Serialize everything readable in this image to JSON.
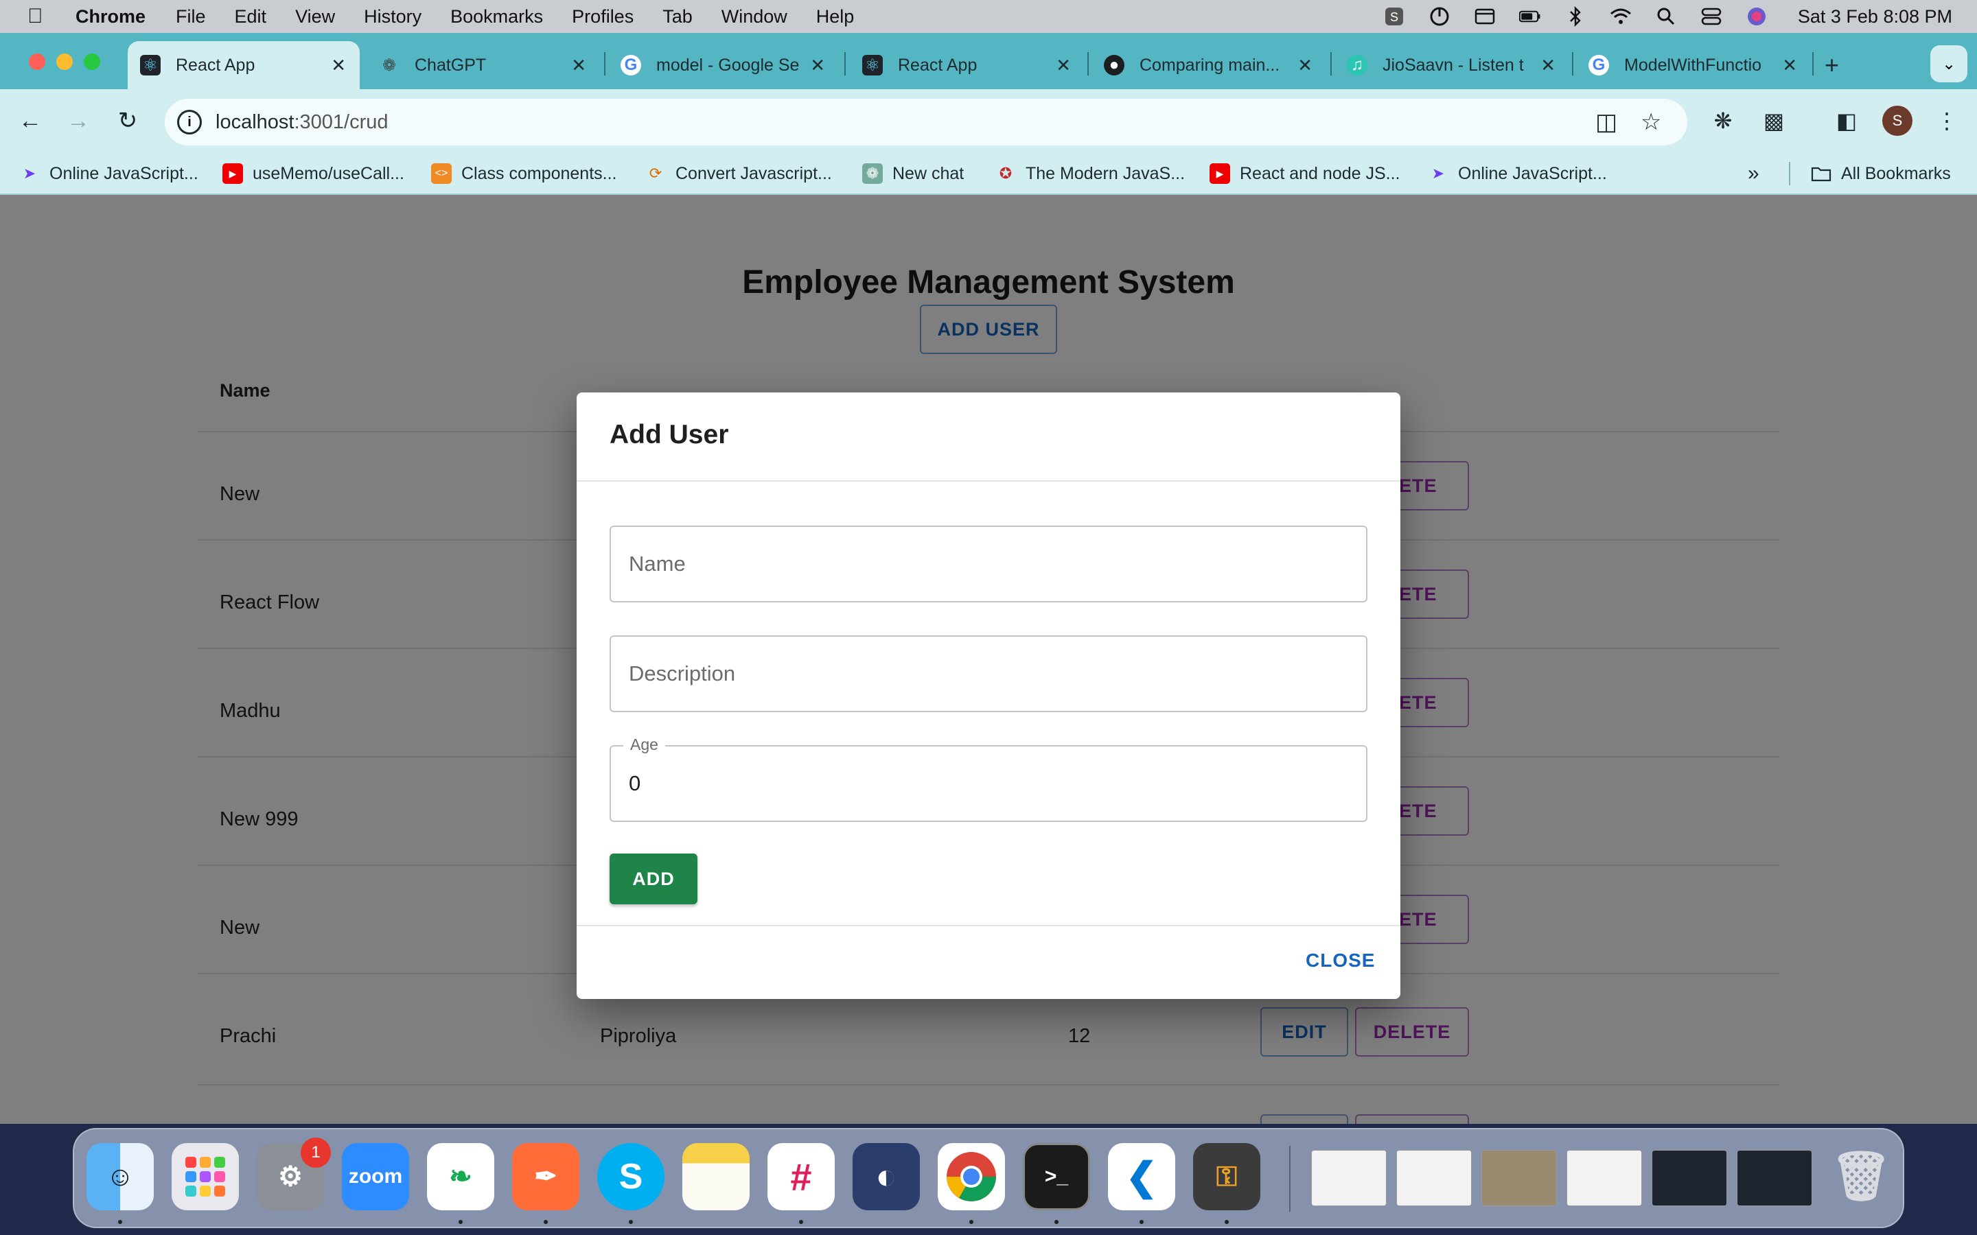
{
  "menubar": {
    "app": "Chrome",
    "menus": [
      "File",
      "Edit",
      "View",
      "History",
      "Bookmarks",
      "Profiles",
      "Tab",
      "Window",
      "Help"
    ],
    "clock": "Sat 3 Feb  8:08 PM"
  },
  "tabs": [
    {
      "label": "React App",
      "icon": "react-icon"
    },
    {
      "label": "ChatGPT",
      "icon": "chatgpt-icon"
    },
    {
      "label": "model - Google Se",
      "icon": "google-icon"
    },
    {
      "label": "React App",
      "icon": "react-icon"
    },
    {
      "label": "Comparing main...",
      "icon": "github-icon"
    },
    {
      "label": "JioSaavn - Listen t",
      "icon": "jiosaavn-icon"
    },
    {
      "label": "ModelWithFunctio",
      "icon": "google-icon"
    }
  ],
  "toolbar": {
    "url_host": "localhost",
    "url_path": ":3001/crud",
    "avatar_initial": "S"
  },
  "bookmarks": {
    "items": [
      {
        "label": "Online JavaScript...",
        "icon": "playcode-icon"
      },
      {
        "label": "useMemo/useCall...",
        "icon": "youtube-icon"
      },
      {
        "label": "Class components...",
        "icon": "codesandbox-icon"
      },
      {
        "label": "Convert Javascript...",
        "icon": "converter-icon"
      },
      {
        "label": "New chat",
        "icon": "chatgpt-icon"
      },
      {
        "label": "The Modern JavaS...",
        "icon": "javascript-info-icon"
      },
      {
        "label": "React and node JS...",
        "icon": "youtube-icon"
      },
      {
        "label": "Online JavaScript...",
        "icon": "playcode-icon"
      }
    ],
    "all_bookmarks": "All Bookmarks"
  },
  "page": {
    "title": "Employee Management System",
    "add_user_label": "ADD USER",
    "col_name": "Name",
    "rows": [
      {
        "name": "New",
        "description": "",
        "age": ""
      },
      {
        "name": "React Flow",
        "description": "",
        "age": ""
      },
      {
        "name": "Madhu",
        "description": "",
        "age": ""
      },
      {
        "name": "New 999",
        "description": "",
        "age": ""
      },
      {
        "name": "New",
        "description": "",
        "age": ""
      },
      {
        "name": "Prachi",
        "description": "Piproliya",
        "age": "12"
      }
    ],
    "edit_label": "EDIT",
    "delete_label": "DELETE",
    "delete_partial": "LETE"
  },
  "dialog": {
    "title": "Add User",
    "name_placeholder": "Name",
    "description_placeholder": "Description",
    "age_label": "Age",
    "age_value": "0",
    "add_label": "ADD",
    "close_label": "CLOSE"
  },
  "dock": {
    "settings_badge": "1",
    "zoom_label": "zoom"
  },
  "colors": {
    "tab_strip": "#54b6c2",
    "toolbar": "#d3eef1",
    "primary": "#1565c0",
    "secondary": "#9c27b0",
    "success": "#1e8448"
  }
}
